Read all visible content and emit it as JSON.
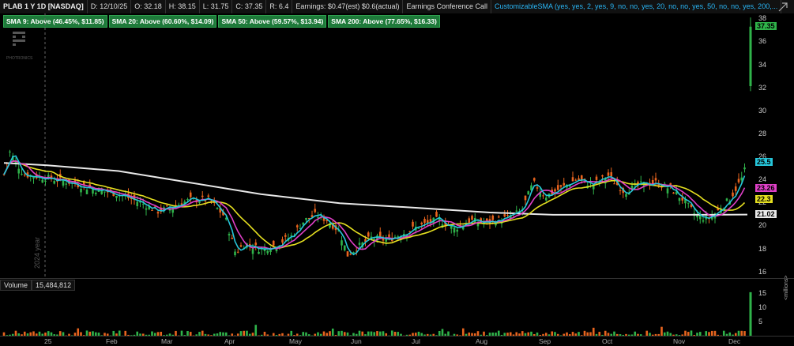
{
  "header": {
    "symbol": "PLAB 1 Y 1D [NASDAQ]",
    "date": "D: 12/10/25",
    "open": "O: 32.18",
    "high": "H: 38.15",
    "low": "L: 31.75",
    "close": "C: 37.35",
    "range": "R: 6.4",
    "earnings": "Earnings: $0.47(est) $0.6(actual)",
    "earnings_call": "Earnings Conference Call",
    "custom_sma": "CustomizableSMA (yes, yes, 2, yes, 9, no, no, yes, 20, no, no, yes, 50, no, no, yes, 200,..."
  },
  "sma_badges": [
    "SMA 9: Above (46.45%, $11.85)",
    "SMA 20: Above (60.60%, $14.09)",
    "SMA 50: Above (59.57%, $13.94)",
    "SMA 200: Above (77.65%, $16.33)"
  ],
  "watermark": "PHOTRONICS",
  "year_label": "2024 year",
  "price_axis": {
    "ticks": [
      "38",
      "36",
      "34",
      "32",
      "30",
      "28",
      "26",
      "24",
      "22",
      "20",
      "18",
      "16"
    ],
    "last_price": "37.35",
    "sma9": "25.5",
    "sma20": "23.26",
    "sma50": "22.3",
    "sma200": "21.02"
  },
  "volume": {
    "label": "Volume",
    "value": "15,484,812",
    "ticks": [
      "15",
      "10",
      "5"
    ],
    "unit": "<millions>"
  },
  "x_axis": [
    "25",
    "Feb",
    "Mar",
    "Apr",
    "May",
    "Jun",
    "Jul",
    "Aug",
    "Sep",
    "Oct",
    "Nov",
    "Dec"
  ],
  "colors": {
    "up": "#2fb34a",
    "down": "#e8641e",
    "sma9": "#26c6da",
    "sma20": "#e040c8",
    "sma50": "#e6e020",
    "sma200": "#e8e8e8",
    "badge": "#1e7a3a"
  },
  "chart_data": {
    "type": "candlestick",
    "x": [
      "25",
      "Feb",
      "Mar",
      "Apr",
      "May",
      "Jun",
      "Jul",
      "Aug",
      "Sep",
      "Oct",
      "Nov",
      "Dec"
    ],
    "close_approx": [
      24.5,
      23.5,
      22.2,
      18.5,
      19.5,
      18.5,
      19.5,
      21.0,
      24.0,
      24.0,
      21.0,
      37.35
    ],
    "sma200_approx": [
      25.5,
      25.0,
      24.0,
      23.0,
      22.3,
      21.8,
      21.5,
      21.2,
      21.0,
      21.0,
      21.0,
      21.02
    ],
    "ylim": [
      15.5,
      38.5
    ]
  }
}
